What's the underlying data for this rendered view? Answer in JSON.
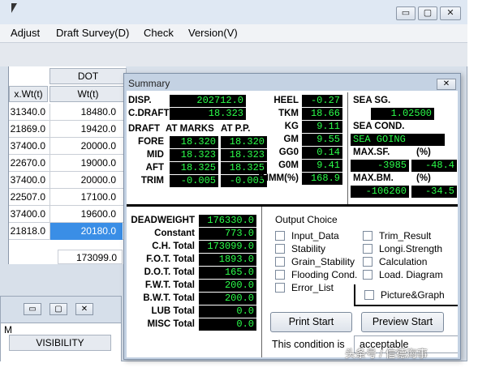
{
  "menu": [
    "Adjust",
    "Draft Survey(D)",
    "Check",
    "Version(V)"
  ],
  "title_buttons": [
    "▭",
    "▢",
    "✕"
  ],
  "grid": {
    "group_header": "DOT",
    "col1_header": "x.Wt(t)",
    "col2_header": "Wt(t)",
    "rows": [
      {
        "a": "31340.0",
        "b": "18480.0"
      },
      {
        "a": "21869.0",
        "b": "19420.0"
      },
      {
        "a": "37400.0",
        "b": "20000.0"
      },
      {
        "a": "22670.0",
        "b": "19000.0"
      },
      {
        "a": "37400.0",
        "b": "20000.0"
      },
      {
        "a": "22507.0",
        "b": "17100.0"
      },
      {
        "a": "37400.0",
        "b": "19600.0"
      },
      {
        "a": "21818.0",
        "b": "20180.0"
      }
    ],
    "total": "173099.0"
  },
  "mini_window": {
    "buttons": [
      "▭",
      "▢",
      "✕"
    ],
    "partial_label": "M",
    "column": "VISIBILITY"
  },
  "summary": {
    "title": "Summary",
    "close": "✕",
    "disp_label": "DISP.",
    "disp": "202712.0",
    "cdraft_label": "C.DRAFT",
    "cdraft": "18.323",
    "draft_label": "DRAFT",
    "at_marks": "AT MARKS",
    "at_pp": "AT P.P.",
    "drafts": [
      {
        "label": "FORE",
        "marks": "18.320",
        "pp": "18.320"
      },
      {
        "label": "MID",
        "marks": "18.323",
        "pp": "18.323"
      },
      {
        "label": "AFT",
        "marks": "18.325",
        "pp": "18.325"
      },
      {
        "label": "TRIM",
        "marks": "-0.005",
        "pp": "-0.005"
      }
    ],
    "hydro": [
      {
        "label": "HEEL",
        "value": "-0.27"
      },
      {
        "label": "TKM",
        "value": "18.66"
      },
      {
        "label": "KG",
        "value": "9.11"
      },
      {
        "label": "GM",
        "value": "9.55"
      },
      {
        "label": "GG0",
        "value": "0.14"
      },
      {
        "label": "G0M",
        "value": "9.41"
      },
      {
        "label": "P.IMM(%)",
        "value": "168.9"
      }
    ],
    "sea_sg_label": "SEA SG.",
    "sea_sg": "1.02500",
    "sea_cond_label": "SEA COND.",
    "sea_cond": "SEA GOING",
    "max_sf_label": "MAX.SF.",
    "max_sf_pct_label": "(%)",
    "max_sf": "-3985",
    "max_sf_pct": "-48.4",
    "max_bm_label": "MAX.BM.",
    "max_bm_pct_label": "(%)",
    "max_bm": "-106260",
    "max_bm_pct": "-34.5",
    "weights": [
      {
        "label": "DEADWEIGHT",
        "value": "176330.0"
      },
      {
        "label": "Constant",
        "value": "773.0"
      },
      {
        "label": "C.H. Total",
        "value": "173099.0"
      },
      {
        "label": "F.O.T. Total",
        "value": "1893.0"
      },
      {
        "label": "D.O.T. Total",
        "value": "165.0"
      },
      {
        "label": "F.W.T. Total",
        "value": "200.0"
      },
      {
        "label": "B.W.T. Total",
        "value": "200.0"
      },
      {
        "label": "LUB Total",
        "value": "0.0"
      },
      {
        "label": "MISC Total",
        "value": "0.0"
      }
    ],
    "output_choice_title": "Output Choice",
    "output_left": [
      "Input_Data",
      "Stability",
      "Grain_Stability",
      "Flooding Cond.",
      "Error_List"
    ],
    "output_right": [
      "Trim_Result",
      "Longi.Strength",
      "Calculation",
      "Load. Diagram"
    ],
    "picture_graph": "Picture&Graph",
    "print_start": "Print Start",
    "preview_start": "Preview Start",
    "condition_label": "This condition is",
    "condition_value": "acceptable"
  },
  "watermark": "头条号 / 信德海事"
}
